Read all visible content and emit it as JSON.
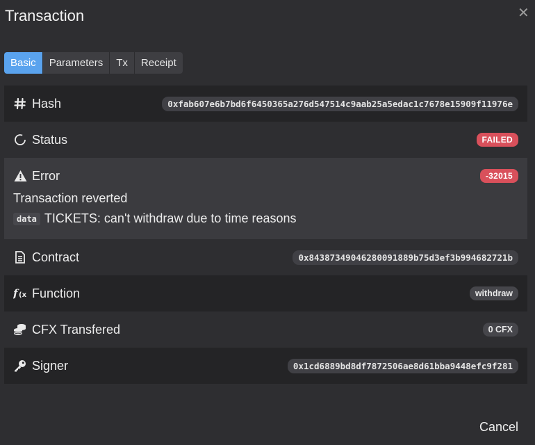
{
  "modal": {
    "title": "Transaction",
    "close_icon": "close-icon"
  },
  "tabs": [
    {
      "label": "Basic",
      "active": true
    },
    {
      "label": "Parameters",
      "active": false
    },
    {
      "label": "Tx",
      "active": false
    },
    {
      "label": "Receipt",
      "active": false
    }
  ],
  "rows": {
    "hash": {
      "label": "Hash",
      "icon": "hash-icon",
      "value": "0xfab607e6b7bd6f6450365a276d547514c9aab25a5edac1c7678e15909f11976e"
    },
    "status": {
      "label": "Status",
      "icon": "spinner-icon",
      "value": "FAILED"
    },
    "error": {
      "label": "Error",
      "icon": "warning-icon",
      "code": "-32015",
      "message": "Transaction reverted",
      "data_tag": "data",
      "data_text": "TICKETS: can't withdraw due to time reasons"
    },
    "contract": {
      "label": "Contract",
      "icon": "document-icon",
      "value": "0x84387349046280091889b75d3ef3b994682721b"
    },
    "function": {
      "label": "Function",
      "icon": "function-icon",
      "value": "withdraw"
    },
    "cfx": {
      "label": "CFX Transfered",
      "icon": "coins-icon",
      "value": "0 CFX"
    },
    "signer": {
      "label": "Signer",
      "icon": "key-icon",
      "value": "0x1cd6889bd8df7872506ae8d61bba9448efc9f281"
    }
  },
  "footer": {
    "cancel_label": "Cancel"
  },
  "colors": {
    "accent": "#5aa3ee",
    "danger": "#d9505b",
    "background": "#2e2e31"
  }
}
